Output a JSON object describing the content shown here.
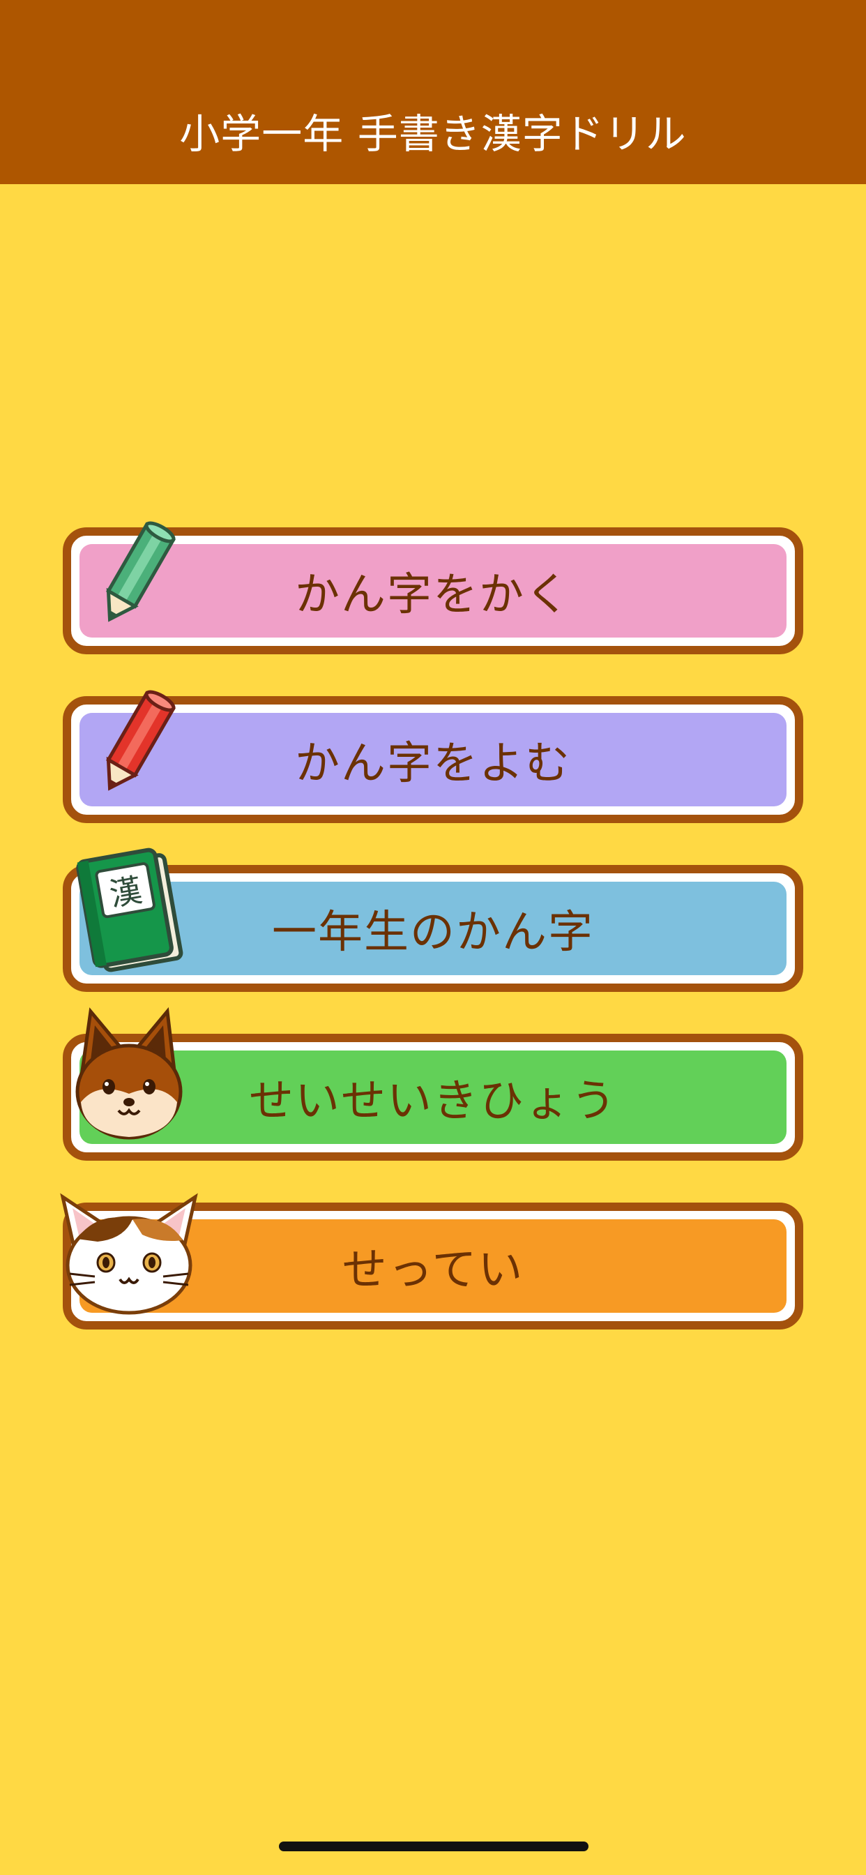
{
  "header": {
    "title": "小学一年 手書き漢字ドリル",
    "background": "#AE5600"
  },
  "page": {
    "background": "#FFD944"
  },
  "menu": {
    "items": [
      {
        "label": "かん字をかく",
        "color": "#F0A0C8",
        "icon": "green-pencil-icon"
      },
      {
        "label": "かん字をよむ",
        "color": "#B2A6F4",
        "icon": "red-pencil-icon"
      },
      {
        "label": "一年生のかん字",
        "color": "#7EC0DE",
        "icon": "kanji-book-icon",
        "icon_text": "漢"
      },
      {
        "label": "せいせいきひょう",
        "color": "#62D058",
        "icon": "dog-face-icon"
      },
      {
        "label": "せってい",
        "color": "#F79A24",
        "icon": "calico-cat-face-icon"
      }
    ],
    "border_color": "#A4520D",
    "text_color": "#6B3104"
  }
}
